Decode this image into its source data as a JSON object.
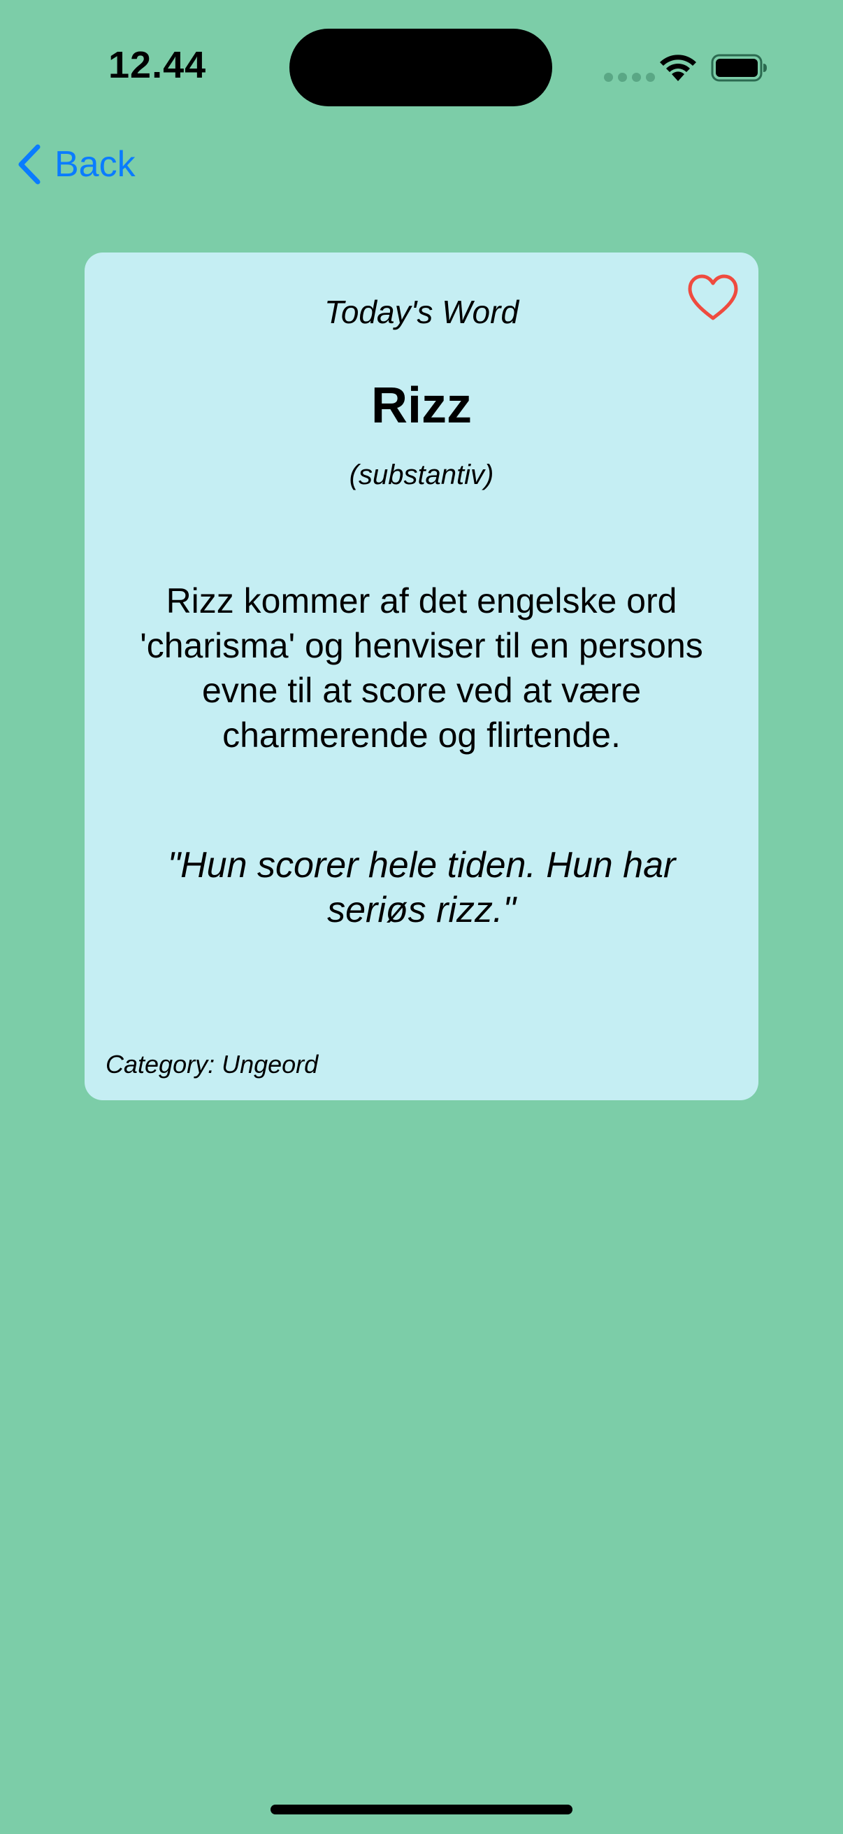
{
  "status_bar": {
    "time": "12.44"
  },
  "nav": {
    "back_label": "Back"
  },
  "card": {
    "heading": "Today's Word",
    "word": "Rizz",
    "part_of_speech": "(substantiv)",
    "definition": "Rizz kommer af det engelske ord 'charisma' og henviser til en persons evne til at score ved at være charmerende og flirtende.",
    "example": "\"Hun scorer hele tiden. Hun har seriøs rizz.\"",
    "category": "Category: Ungeord",
    "favorite_icon": "heart-outline-icon"
  },
  "colors": {
    "background": "#7ccda8",
    "card_background": "#c5eef3",
    "accent": "#0a7cff",
    "heart": "#ef4b3f"
  }
}
